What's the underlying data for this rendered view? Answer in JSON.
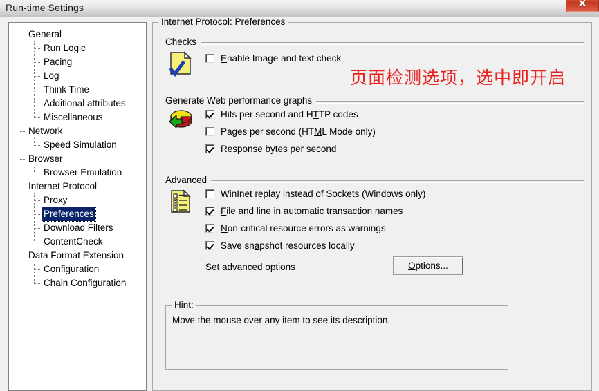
{
  "window": {
    "title": "Run-time Settings",
    "close_label": "✕"
  },
  "tree": {
    "items": [
      {
        "label": "General",
        "level": 0,
        "selected": false
      },
      {
        "label": "Run Logic",
        "level": 1,
        "selected": false
      },
      {
        "label": "Pacing",
        "level": 1,
        "selected": false
      },
      {
        "label": "Log",
        "level": 1,
        "selected": false
      },
      {
        "label": "Think Time",
        "level": 1,
        "selected": false
      },
      {
        "label": "Additional attributes",
        "level": 1,
        "selected": false
      },
      {
        "label": "Miscellaneous",
        "level": 1,
        "selected": false,
        "last": true
      },
      {
        "label": "Network",
        "level": 0,
        "selected": false
      },
      {
        "label": "Speed Simulation",
        "level": 1,
        "selected": false,
        "last": true
      },
      {
        "label": "Browser",
        "level": 0,
        "selected": false
      },
      {
        "label": "Browser Emulation",
        "level": 1,
        "selected": false,
        "last": true
      },
      {
        "label": "Internet Protocol",
        "level": 0,
        "selected": false
      },
      {
        "label": "Proxy",
        "level": 1,
        "selected": false
      },
      {
        "label": "Preferences",
        "level": 1,
        "selected": true
      },
      {
        "label": "Download Filters",
        "level": 1,
        "selected": false
      },
      {
        "label": "ContentCheck",
        "level": 1,
        "selected": false,
        "last": true
      },
      {
        "label": "Data Format Extension",
        "level": 0,
        "selected": false,
        "last": true
      },
      {
        "label": "Configuration",
        "level": 1,
        "selected": false
      },
      {
        "label": "Chain Configuration",
        "level": 1,
        "selected": false,
        "last": true
      }
    ]
  },
  "panel": {
    "title": "Internet Protocol: Preferences",
    "sections": {
      "checks": {
        "label": "Checks",
        "icon": "yellow-document-check-icon",
        "options": [
          {
            "label_pre": "",
            "accel": "E",
            "label_post": "nable Image and text check",
            "checked": false
          }
        ]
      },
      "graphs": {
        "label": "Generate Web performance graphs",
        "icon": "pie-chart-icon",
        "options": [
          {
            "label_pre": "Hits per second and H",
            "accel": "T",
            "label_post": "TP codes",
            "checked": true
          },
          {
            "label_pre": "Pages per second (HT",
            "accel": "M",
            "label_post": "L Mode only)",
            "checked": false
          },
          {
            "label_pre": "",
            "accel": "R",
            "label_post": "esponse bytes per second",
            "checked": true
          }
        ]
      },
      "advanced": {
        "label": "Advanced",
        "icon": "checklist-document-icon",
        "options": [
          {
            "label_pre": "",
            "accel": "Wi",
            "label_post": "nInet replay instead of Sockets (Windows only)",
            "checked": false
          },
          {
            "label_pre": "",
            "accel": "F",
            "label_post": "ile and line in automatic transaction names",
            "checked": true
          },
          {
            "label_pre": "",
            "accel": "N",
            "label_post": "on-critical resource errors as warnings",
            "checked": true
          },
          {
            "label_pre": "Save sn",
            "accel": "a",
            "label_post": "pshot resources locally",
            "checked": true
          }
        ],
        "set_options_text": "Set advanced options",
        "options_button_pre": "",
        "options_button_accel": "O",
        "options_button_post": "ptions..."
      }
    },
    "hint": {
      "title": "Hint:",
      "text": "Move the mouse over any item to see its description."
    }
  },
  "annotation": {
    "text": "页面检测选项，选中即开启",
    "color": "#e8231f"
  }
}
